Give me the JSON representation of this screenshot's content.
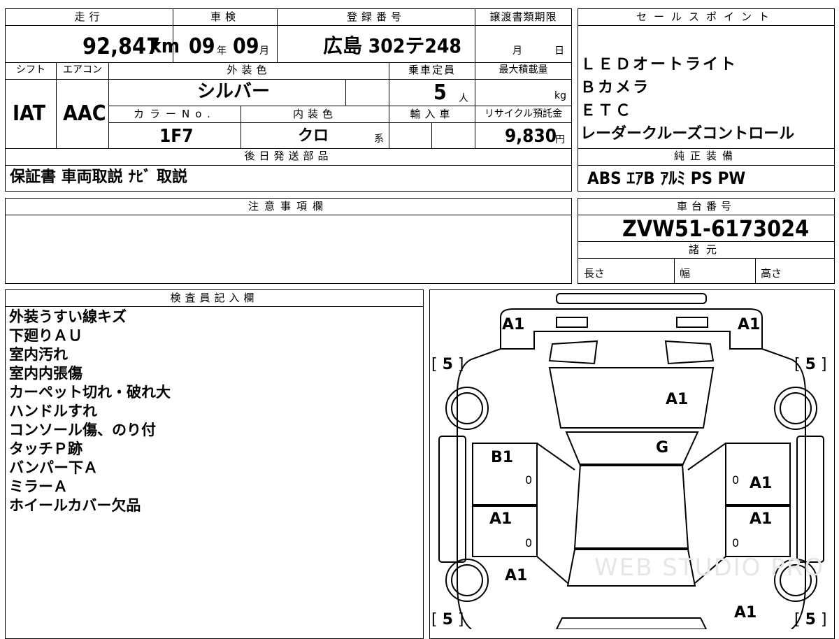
{
  "vehicle": {
    "mileage_label": "走行",
    "mileage": "92,847",
    "mileage_unit": "km",
    "inspection_label": "車検",
    "inspection_year": "09",
    "year_unit": "年",
    "inspection_month": "09",
    "month_unit": "月",
    "reg_label": "登録番号",
    "reg_number": "広島 302テ248",
    "transfer_label": "譲渡書類期限",
    "transfer_month_unit": "月",
    "transfer_day_unit": "日",
    "shift_label": "シフト",
    "shift": "IAT",
    "ac_label": "エアコン",
    "ac": "AAC",
    "exterior_color_label": "外装色",
    "exterior_color": "シルバー",
    "capacity_label": "乗車定員",
    "capacity": "5",
    "capacity_unit": "人",
    "max_load_label": "最大積載量",
    "max_load_unit": "kg",
    "color_no_label": "カラーNo.",
    "color_no": "1F7",
    "interior_color_label": "内装色",
    "interior_color": "クロ",
    "interior_color_suffix": "系",
    "import_label": "輸入車",
    "recycle_label": "リサイクル預託金",
    "recycle_fee": "9,830",
    "recycle_unit": "円",
    "later_parts_label": "後日発送部品",
    "later_parts": "保証書 車両取説 ﾅﾋﾞ 取説",
    "caution_label": "注意事項欄"
  },
  "sales_points": {
    "label": "セールスポイント",
    "items": [
      "ＬＥＤオートライト",
      "Ｂカメラ",
      "ＥＴＣ",
      "レーダークルーズコントロール"
    ]
  },
  "equipment": {
    "label": "純正装備",
    "value": "ABS ｴｱB ｱﾙﾐ PS PW"
  },
  "chassis": {
    "label": "車台番号",
    "value": "ZVW51-6173024"
  },
  "specs": {
    "label": "諸元",
    "length_label": "長さ",
    "width_label": "幅",
    "height_label": "高さ"
  },
  "inspector": {
    "label": "検査員記入欄",
    "notes": [
      "外装うすい線キズ",
      "下廻りＡＵ",
      "室内汚れ",
      "室内内張傷",
      "カーペット切れ・破れ大",
      "ハンドルすれ",
      "コンソール傷、のり付",
      "タッチＰ跡",
      "バンパー下Ａ",
      "ミラーＡ",
      "ホイールカバー欠品"
    ]
  },
  "diagram": {
    "grades": {
      "front_left": "A1",
      "front_right": "A1",
      "hood": "A1",
      "windshield": "G",
      "front_door_left": "B1",
      "front_door_right": "A1",
      "rear_door_left": "A1",
      "rear_door_right": "A1",
      "rear_fender_left": "A1",
      "rear_right": "A1"
    },
    "tires": {
      "front_left": "5",
      "front_right": "5",
      "rear_left": "5",
      "rear_right": "5"
    },
    "zero": "0",
    "watermark": "WEB STUDIO PRO"
  }
}
